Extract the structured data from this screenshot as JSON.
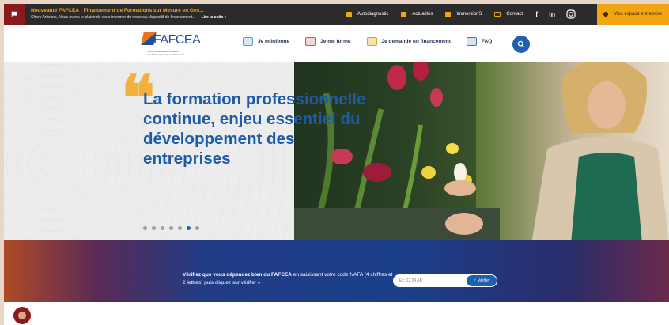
{
  "topbar": {
    "news_title": "Nouveauté FAFCEA : Financement de Formations sur Mesure en Ges...",
    "news_text": "Chers Artisans, Nous avons le plaisir de vous informer du nouveau dispositif de financement...",
    "news_more": "Lire la suite »",
    "links": [
      {
        "label": "Autodiagnostic"
      },
      {
        "label": "Actualités"
      },
      {
        "label": "ImmersionS"
      },
      {
        "label": "Contact"
      }
    ],
    "social": [
      "f",
      "in"
    ],
    "space_label": "Mon espace entreprise"
  },
  "header": {
    "logo_text": "FAFCEA",
    "logo_sub1": "Fonds d'Assurance Formation",
    "logo_sub2": "des Chefs d'Entreprises Artisanales",
    "nav": [
      {
        "label": "Je m'informe"
      },
      {
        "label": "Je me forme"
      },
      {
        "label": "Je demande un financement"
      },
      {
        "label": "FAQ"
      }
    ]
  },
  "hero": {
    "quote_mark": "❝",
    "title": "La formation professionnelle continue, enjeu essentiel du développement des entreprises",
    "slides": 7,
    "active_slide": 6
  },
  "banner": {
    "text_bold": "Vérifiez que vous dépendez bien du FAFCEA",
    "text_rest": " en saisissant votre code NAFA (4 chiffres et 2 lettres) puis cliquez sur vérifier",
    "info_icon": "●",
    "input_placeholder": "Ex: 12.34 AB",
    "button_label": "✓ Vérifier"
  },
  "colors": {
    "accent": "#f2a413",
    "primary": "#1f5fb0",
    "title_blue": "#1d5aa8",
    "dark_red": "#8b1a1f"
  }
}
